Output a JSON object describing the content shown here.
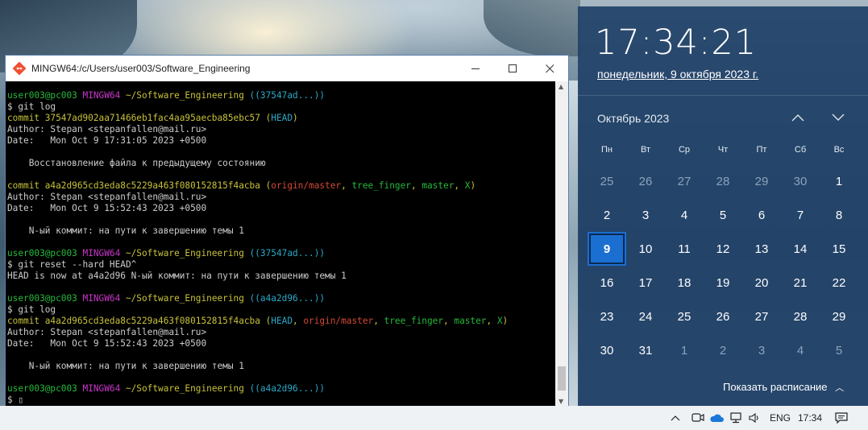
{
  "terminal": {
    "title": "MINGW64:/c/Users/user003/Software_Engineering",
    "lines": [
      [
        {
          "t": "user003@pc003 ",
          "c": "c-green"
        },
        {
          "t": "MINGW64 ",
          "c": "c-magenta"
        },
        {
          "t": "~/Software_Engineering ",
          "c": "c-yellow"
        },
        {
          "t": "((37547ad...))",
          "c": "c-cyan"
        }
      ],
      [
        {
          "t": "$ git log",
          "c": "c-white"
        }
      ],
      [
        {
          "t": "commit 37547ad902aa71466eb1fac4aa95aecba85ebc57 ",
          "c": "c-commit"
        },
        {
          "t": "(",
          "c": "c-commit"
        },
        {
          "t": "HEAD",
          "c": "c-cyan"
        },
        {
          "t": ")",
          "c": "c-commit"
        }
      ],
      [
        {
          "t": "Author: Stepan <stepanfallen@mail.ru>",
          "c": "c-white"
        }
      ],
      [
        {
          "t": "Date:   Mon Oct 9 17:31:05 2023 +0500",
          "c": "c-white"
        }
      ],
      [
        {
          "t": "",
          "c": "c-white"
        }
      ],
      [
        {
          "t": "    Восстановление файла к предыдущему состоянию",
          "c": "c-white"
        }
      ],
      [
        {
          "t": "",
          "c": "c-white"
        }
      ],
      [
        {
          "t": "commit a4a2d965cd3eda8c5229a463f080152815f4acba ",
          "c": "c-commit"
        },
        {
          "t": "(",
          "c": "c-commit"
        },
        {
          "t": "origin/master",
          "c": "c-red"
        },
        {
          "t": ", ",
          "c": "c-commit"
        },
        {
          "t": "tree_finger",
          "c": "c-green"
        },
        {
          "t": ", ",
          "c": "c-commit"
        },
        {
          "t": "master",
          "c": "c-green"
        },
        {
          "t": ", ",
          "c": "c-commit"
        },
        {
          "t": "X",
          "c": "c-green"
        },
        {
          "t": ")",
          "c": "c-commit"
        }
      ],
      [
        {
          "t": "Author: Stepan <stepanfallen@mail.ru>",
          "c": "c-white"
        }
      ],
      [
        {
          "t": "Date:   Mon Oct 9 15:52:43 2023 +0500",
          "c": "c-white"
        }
      ],
      [
        {
          "t": "",
          "c": "c-white"
        }
      ],
      [
        {
          "t": "    N-ый коммит: на пути к завершению темы 1",
          "c": "c-white"
        }
      ],
      [
        {
          "t": "",
          "c": "c-white"
        }
      ],
      [
        {
          "t": "user003@pc003 ",
          "c": "c-green"
        },
        {
          "t": "MINGW64 ",
          "c": "c-magenta"
        },
        {
          "t": "~/Software_Engineering ",
          "c": "c-yellow"
        },
        {
          "t": "((37547ad...))",
          "c": "c-cyan"
        }
      ],
      [
        {
          "t": "$ git reset --hard HEAD^",
          "c": "c-white"
        }
      ],
      [
        {
          "t": "HEAD is now at a4a2d96 N-ый коммит: на пути к завершению темы 1",
          "c": "c-white"
        }
      ],
      [
        {
          "t": "",
          "c": "c-white"
        }
      ],
      [
        {
          "t": "user003@pc003 ",
          "c": "c-green"
        },
        {
          "t": "MINGW64 ",
          "c": "c-magenta"
        },
        {
          "t": "~/Software_Engineering ",
          "c": "c-yellow"
        },
        {
          "t": "((a4a2d96...))",
          "c": "c-cyan"
        }
      ],
      [
        {
          "t": "$ git log",
          "c": "c-white"
        }
      ],
      [
        {
          "t": "commit a4a2d965cd3eda8c5229a463f080152815f4acba ",
          "c": "c-commit"
        },
        {
          "t": "(",
          "c": "c-commit"
        },
        {
          "t": "HEAD",
          "c": "c-cyan"
        },
        {
          "t": ", ",
          "c": "c-commit"
        },
        {
          "t": "origin/master",
          "c": "c-red"
        },
        {
          "t": ", ",
          "c": "c-commit"
        },
        {
          "t": "tree_finger",
          "c": "c-green"
        },
        {
          "t": ", ",
          "c": "c-commit"
        },
        {
          "t": "master",
          "c": "c-green"
        },
        {
          "t": ", ",
          "c": "c-commit"
        },
        {
          "t": "X",
          "c": "c-green"
        },
        {
          "t": ")",
          "c": "c-commit"
        }
      ],
      [
        {
          "t": "Author: Stepan <stepanfallen@mail.ru>",
          "c": "c-white"
        }
      ],
      [
        {
          "t": "Date:   Mon Oct 9 15:52:43 2023 +0500",
          "c": "c-white"
        }
      ],
      [
        {
          "t": "",
          "c": "c-white"
        }
      ],
      [
        {
          "t": "    N-ый коммит: на пути к завершению темы 1",
          "c": "c-white"
        }
      ],
      [
        {
          "t": "",
          "c": "c-white"
        }
      ],
      [
        {
          "t": "user003@pc003 ",
          "c": "c-green"
        },
        {
          "t": "MINGW64 ",
          "c": "c-magenta"
        },
        {
          "t": "~/Software_Engineering ",
          "c": "c-yellow"
        },
        {
          "t": "((a4a2d96...))",
          "c": "c-cyan"
        }
      ],
      [
        {
          "t": "$ ",
          "c": "c-white"
        },
        {
          "t": "▯",
          "c": "c-white"
        }
      ]
    ]
  },
  "window_buttons": {
    "minimize": "—",
    "maximize": "☐",
    "close": "✕"
  },
  "flyout": {
    "time": "17:34:21",
    "date": "понедельник, 9 октября 2023 г.",
    "month_title": "Октябрь 2023",
    "prev_icon": "chevron-up-icon",
    "next_icon": "chevron-down-icon",
    "weekdays": [
      "Пн",
      "Вт",
      "Ср",
      "Чт",
      "Пт",
      "Сб",
      "Вс"
    ],
    "days": [
      {
        "n": "25",
        "dim": true
      },
      {
        "n": "26",
        "dim": true
      },
      {
        "n": "27",
        "dim": true
      },
      {
        "n": "28",
        "dim": true
      },
      {
        "n": "29",
        "dim": true
      },
      {
        "n": "30",
        "dim": true
      },
      {
        "n": "1",
        "dim": false
      },
      {
        "n": "2",
        "dim": false
      },
      {
        "n": "3",
        "dim": false
      },
      {
        "n": "4",
        "dim": false
      },
      {
        "n": "5",
        "dim": false
      },
      {
        "n": "6",
        "dim": false
      },
      {
        "n": "7",
        "dim": false
      },
      {
        "n": "8",
        "dim": false
      },
      {
        "n": "9",
        "dim": false,
        "today": true
      },
      {
        "n": "10",
        "dim": false
      },
      {
        "n": "11",
        "dim": false
      },
      {
        "n": "12",
        "dim": false
      },
      {
        "n": "13",
        "dim": false
      },
      {
        "n": "14",
        "dim": false
      },
      {
        "n": "15",
        "dim": false
      },
      {
        "n": "16",
        "dim": false
      },
      {
        "n": "17",
        "dim": false
      },
      {
        "n": "18",
        "dim": false
      },
      {
        "n": "19",
        "dim": false
      },
      {
        "n": "20",
        "dim": false
      },
      {
        "n": "21",
        "dim": false
      },
      {
        "n": "22",
        "dim": false
      },
      {
        "n": "23",
        "dim": false
      },
      {
        "n": "24",
        "dim": false
      },
      {
        "n": "25",
        "dim": false
      },
      {
        "n": "26",
        "dim": false
      },
      {
        "n": "27",
        "dim": false
      },
      {
        "n": "28",
        "dim": false
      },
      {
        "n": "29",
        "dim": false
      },
      {
        "n": "30",
        "dim": false
      },
      {
        "n": "31",
        "dim": false
      },
      {
        "n": "1",
        "dim": true
      },
      {
        "n": "2",
        "dim": true
      },
      {
        "n": "3",
        "dim": true
      },
      {
        "n": "4",
        "dim": true
      },
      {
        "n": "5",
        "dim": true
      }
    ],
    "agenda_label": "Показать расписание"
  },
  "taskbar": {
    "language": "ENG",
    "clock": "17:34"
  },
  "colors": {
    "accent_today": "#1b6fd1",
    "flyout_bg": "#214268",
    "prompt_green": "#26b83b",
    "prompt_magenta": "#c936c9",
    "prompt_yellow": "#c8c23b",
    "branch_cyan": "#2aa9c9",
    "remote_red": "#d54a36"
  }
}
